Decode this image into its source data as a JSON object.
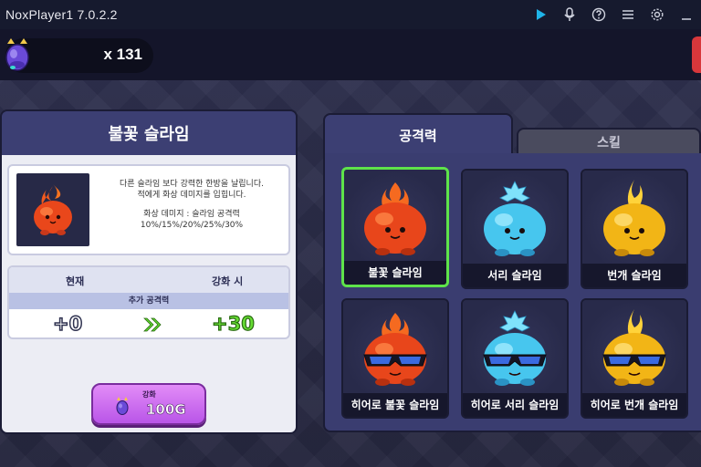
{
  "window": {
    "title": "NoxPlayer1 7.0.2.2",
    "toolbar_icons": [
      "play-icon",
      "microphone-icon",
      "help-icon",
      "menu-icon",
      "settings-icon",
      "minimize-icon"
    ]
  },
  "currency": {
    "icon": "gem-icon",
    "amount": "x 131"
  },
  "detail_panel": {
    "title": "불꽃 슬라임",
    "description_line1": "다른 슬라임 보다 강력한 한방을 날립니다.",
    "description_line2": "적에게 화상 데미지를 입힙니다.",
    "description_line3": "화상 데미지 : 슬라임 공격력",
    "description_line4": "10%/15%/20%/25%/30%",
    "stats": {
      "current_header": "현재",
      "upgrade_header": "강화 시",
      "stat_name": "추가 공격력",
      "current_value": "+0",
      "upgrade_value": "+30"
    },
    "upgrade_button": {
      "label": "강화",
      "price": "100G"
    }
  },
  "tabs": [
    {
      "label": "공격력",
      "active": true
    },
    {
      "label": "스킬",
      "active": false
    }
  ],
  "slimes": [
    {
      "name": "불꽃 슬라임",
      "element": "fire",
      "hero": false,
      "selected": true
    },
    {
      "name": "서리 슬라임",
      "element": "frost",
      "hero": false,
      "selected": false
    },
    {
      "name": "번개 슬라임",
      "element": "lightning",
      "hero": false,
      "selected": false
    },
    {
      "name": "히어로 불꽃 슬라임",
      "element": "fire",
      "hero": true,
      "selected": false
    },
    {
      "name": "히어로 서리 슬라임",
      "element": "frost",
      "hero": true,
      "selected": false
    },
    {
      "name": "히어로 번개 슬라임",
      "element": "lightning",
      "hero": true,
      "selected": false
    }
  ],
  "colors": {
    "fire": "#f04a1c",
    "frost": "#4fd0f0",
    "lightning": "#f7c21a",
    "selected_border": "#5ee34a",
    "upgrade_value": "#66dd33"
  }
}
